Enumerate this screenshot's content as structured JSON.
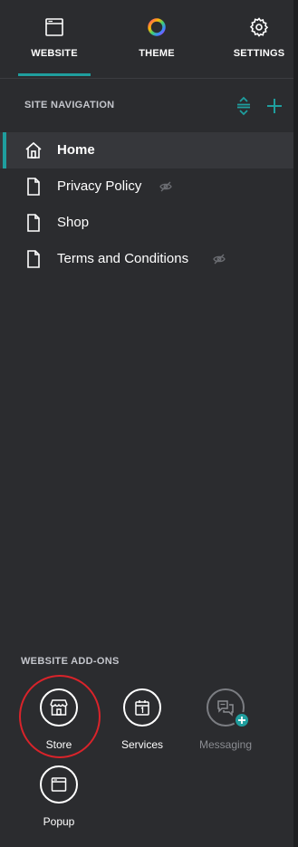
{
  "tabs": {
    "website": "WEBSITE",
    "theme": "THEME",
    "settings": "SETTINGS",
    "active": "website"
  },
  "site_navigation": {
    "header": "SITE NAVIGATION",
    "pages": [
      {
        "label": "Home",
        "icon": "home-icon",
        "active": true,
        "hidden": false
      },
      {
        "label": "Privacy Policy",
        "icon": "page-icon",
        "active": false,
        "hidden": true
      },
      {
        "label": "Shop",
        "icon": "page-icon",
        "active": false,
        "hidden": false
      },
      {
        "label": "Terms and Conditions",
        "icon": "page-icon",
        "active": false,
        "hidden": true
      }
    ]
  },
  "addons": {
    "header": "WEBSITE ADD-ONS",
    "items": [
      {
        "label": "Store",
        "icon": "store-icon",
        "enabled": true
      },
      {
        "label": "Services",
        "icon": "calendar-icon",
        "enabled": true
      },
      {
        "label": "Messaging",
        "icon": "chat-icon",
        "enabled": false
      },
      {
        "label": "Popup",
        "icon": "popup-window-icon",
        "enabled": true
      }
    ]
  },
  "colors": {
    "background": "#2b2c2f",
    "accent": "#1f9e9e",
    "highlight": "#d9232a"
  }
}
